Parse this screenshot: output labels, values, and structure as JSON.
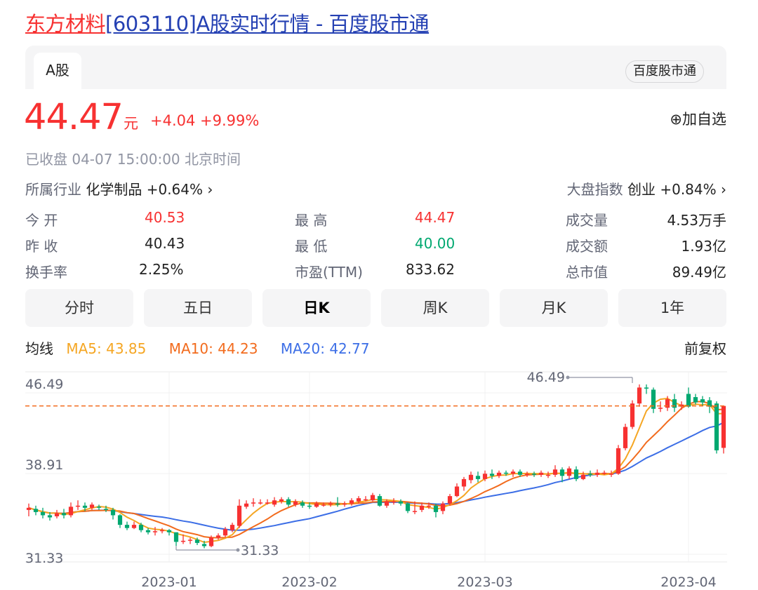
{
  "page_title": {
    "name": "东方材料",
    "code": "[603110]A股实时行情 - 百度股市通"
  },
  "tabs": {
    "active": "A股",
    "source": "百度股市通"
  },
  "quote": {
    "price": "44.47",
    "unit": "元",
    "change": "+4.04",
    "change_pct": "+9.99%",
    "watch_label": "⊕加自选",
    "status": "已收盘  04-07 15:00:00  北京时间",
    "industry_label": "所属行业",
    "industry_value": "化学制品 +0.64% ›",
    "index_label": "大盘指数",
    "index_value": "创业 +0.84% ›"
  },
  "stats": [
    {
      "label": "今    开",
      "value": "40.53",
      "color": "#f73131"
    },
    {
      "label": "最    高",
      "value": "44.47",
      "color": "#f73131"
    },
    {
      "label": "成交量",
      "value": "4.53万手",
      "color": "#222222"
    },
    {
      "label": "昨    收",
      "value": "40.43",
      "color": "#222222"
    },
    {
      "label": "最    低",
      "value": "40.00",
      "color": "#00a870"
    },
    {
      "label": "成交额",
      "value": "1.93亿",
      "color": "#222222"
    },
    {
      "label": "换手率",
      "value": "2.25%",
      "color": "#222222"
    },
    {
      "label": "市盈(TTM)",
      "value": "833.62",
      "color": "#222222"
    },
    {
      "label": "总市值",
      "value": "89.49亿",
      "color": "#222222"
    }
  ],
  "periods": [
    "分时",
    "五日",
    "日K",
    "周K",
    "月K",
    "1年"
  ],
  "active_period": "日K",
  "legend": {
    "label": "均线",
    "ma5": "MA5: 43.85",
    "ma10": "MA10: 44.23",
    "ma20": "MA20: 42.77",
    "adjust": "前复权"
  },
  "colors": {
    "up": "#f73131",
    "down": "#00a870",
    "ma5": "#f5a623",
    "ma10": "#f26b1d",
    "ma20": "#3c6ee6",
    "last_price_line": "#f26b1d"
  },
  "chart_data": {
    "type": "candlestick",
    "ylim": [
      31.33,
      46.49
    ],
    "y_ticks": [
      "46.49",
      "38.91",
      "31.33"
    ],
    "x_ticks": [
      "2023-01",
      "2023-02",
      "2023-03",
      "2023-04"
    ],
    "x_tick_index": [
      20,
      40,
      65,
      94
    ],
    "high_marker": {
      "label": "46.49",
      "value": 46.49,
      "index": 86
    },
    "low_marker": {
      "label": "31.33",
      "value": 31.33,
      "index": 21
    },
    "last_price": 44.47,
    "candles": [
      {
        "o": 34.7,
        "c": 34.9,
        "h": 35.3,
        "l": 34.1
      },
      {
        "o": 34.8,
        "c": 34.5,
        "h": 35.1,
        "l": 34.2
      },
      {
        "o": 34.5,
        "c": 34.2,
        "h": 34.9,
        "l": 33.9
      },
      {
        "o": 34.2,
        "c": 34.0,
        "h": 34.5,
        "l": 33.7
      },
      {
        "o": 34.1,
        "c": 34.4,
        "h": 34.7,
        "l": 33.9
      },
      {
        "o": 34.4,
        "c": 34.2,
        "h": 34.8,
        "l": 33.9
      },
      {
        "o": 34.2,
        "c": 35.0,
        "h": 35.4,
        "l": 34.0
      },
      {
        "o": 35.0,
        "c": 35.1,
        "h": 35.6,
        "l": 34.7
      },
      {
        "o": 35.1,
        "c": 34.9,
        "h": 35.4,
        "l": 34.6
      },
      {
        "o": 34.9,
        "c": 35.2,
        "h": 35.4,
        "l": 34.7
      },
      {
        "o": 35.0,
        "c": 34.9,
        "h": 35.2,
        "l": 34.7
      },
      {
        "o": 34.8,
        "c": 34.7,
        "h": 35.1,
        "l": 34.5
      },
      {
        "o": 34.7,
        "c": 34.2,
        "h": 34.9,
        "l": 33.8
      },
      {
        "o": 34.2,
        "c": 33.3,
        "h": 34.3,
        "l": 33.0
      },
      {
        "o": 33.3,
        "c": 33.0,
        "h": 33.6,
        "l": 32.8
      },
      {
        "o": 33.0,
        "c": 33.3,
        "h": 33.6,
        "l": 32.9
      },
      {
        "o": 33.3,
        "c": 32.8,
        "h": 33.5,
        "l": 32.6
      },
      {
        "o": 32.8,
        "c": 32.6,
        "h": 33.0,
        "l": 32.4
      },
      {
        "o": 32.6,
        "c": 32.7,
        "h": 33.1,
        "l": 32.3
      },
      {
        "o": 32.7,
        "c": 32.8,
        "h": 33.0,
        "l": 32.5
      },
      {
        "o": 32.8,
        "c": 32.6,
        "h": 32.9,
        "l": 32.3
      },
      {
        "o": 32.6,
        "c": 31.7,
        "h": 32.6,
        "l": 31.33
      },
      {
        "o": 31.8,
        "c": 31.8,
        "h": 32.4,
        "l": 31.5
      },
      {
        "o": 31.8,
        "c": 31.9,
        "h": 32.1,
        "l": 31.5
      },
      {
        "o": 31.9,
        "c": 31.6,
        "h": 32.1,
        "l": 31.4
      },
      {
        "o": 31.5,
        "c": 31.3,
        "h": 31.8,
        "l": 31.1
      },
      {
        "o": 31.3,
        "c": 32.1,
        "h": 32.3,
        "l": 31.2
      },
      {
        "o": 32.1,
        "c": 32.3,
        "h": 32.5,
        "l": 31.9
      },
      {
        "o": 32.3,
        "c": 32.9,
        "h": 33.1,
        "l": 32.1
      },
      {
        "o": 32.8,
        "c": 33.3,
        "h": 33.5,
        "l": 32.6
      },
      {
        "o": 33.2,
        "c": 35.1,
        "h": 35.7,
        "l": 33.0
      },
      {
        "o": 35.0,
        "c": 35.3,
        "h": 35.6,
        "l": 34.8
      },
      {
        "o": 35.3,
        "c": 35.4,
        "h": 35.8,
        "l": 35.0
      },
      {
        "o": 35.4,
        "c": 35.4,
        "h": 35.7,
        "l": 35.2
      },
      {
        "o": 35.4,
        "c": 35.4,
        "h": 35.7,
        "l": 35.2
      },
      {
        "o": 35.2,
        "c": 35.6,
        "h": 35.9,
        "l": 35.0
      },
      {
        "o": 35.5,
        "c": 35.7,
        "h": 35.9,
        "l": 35.3
      },
      {
        "o": 35.7,
        "c": 35.2,
        "h": 35.9,
        "l": 35.0
      },
      {
        "o": 35.2,
        "c": 35.5,
        "h": 35.7,
        "l": 35.0
      },
      {
        "o": 35.4,
        "c": 35.1,
        "h": 35.6,
        "l": 34.9
      },
      {
        "o": 35.1,
        "c": 35.0,
        "h": 35.4,
        "l": 34.8
      },
      {
        "o": 35.0,
        "c": 35.3,
        "h": 35.5,
        "l": 34.9
      },
      {
        "o": 35.2,
        "c": 35.2,
        "h": 35.4,
        "l": 35.0
      },
      {
        "o": 35.2,
        "c": 35.3,
        "h": 35.5,
        "l": 35.0
      },
      {
        "o": 35.3,
        "c": 35.2,
        "h": 35.9,
        "l": 35.0
      },
      {
        "o": 35.2,
        "c": 35.3,
        "h": 35.5,
        "l": 35.0
      },
      {
        "o": 35.3,
        "c": 35.6,
        "h": 35.8,
        "l": 35.1
      },
      {
        "o": 35.5,
        "c": 35.8,
        "h": 36.0,
        "l": 35.3
      },
      {
        "o": 35.7,
        "c": 35.7,
        "h": 36.0,
        "l": 35.5
      },
      {
        "o": 35.6,
        "c": 36.1,
        "h": 36.3,
        "l": 35.5
      },
      {
        "o": 36.0,
        "c": 35.1,
        "h": 36.2,
        "l": 35.0
      },
      {
        "o": 35.1,
        "c": 35.5,
        "h": 35.7,
        "l": 34.9
      },
      {
        "o": 35.4,
        "c": 35.5,
        "h": 35.8,
        "l": 35.2
      },
      {
        "o": 35.5,
        "c": 35.3,
        "h": 35.7,
        "l": 35.1
      },
      {
        "o": 35.3,
        "c": 34.6,
        "h": 35.4,
        "l": 34.4
      },
      {
        "o": 34.6,
        "c": 34.6,
        "h": 35.5,
        "l": 34.3
      },
      {
        "o": 34.7,
        "c": 35.1,
        "h": 35.4,
        "l": 34.5
      },
      {
        "o": 35.1,
        "c": 35.1,
        "h": 35.4,
        "l": 34.8
      },
      {
        "o": 35.1,
        "c": 34.5,
        "h": 35.3,
        "l": 34.0
      },
      {
        "o": 34.6,
        "c": 35.3,
        "h": 35.5,
        "l": 34.3
      },
      {
        "o": 35.3,
        "c": 36.0,
        "h": 36.2,
        "l": 35.1
      },
      {
        "o": 36.0,
        "c": 36.9,
        "h": 37.2,
        "l": 35.9
      },
      {
        "o": 36.9,
        "c": 37.6,
        "h": 37.8,
        "l": 36.5
      },
      {
        "o": 37.5,
        "c": 38.0,
        "h": 38.3,
        "l": 37.2
      },
      {
        "o": 37.9,
        "c": 37.6,
        "h": 38.3,
        "l": 37.3
      },
      {
        "o": 37.6,
        "c": 38.1,
        "h": 38.4,
        "l": 37.4
      },
      {
        "o": 38.1,
        "c": 37.9,
        "h": 38.5,
        "l": 37.6
      },
      {
        "o": 37.9,
        "c": 38.2,
        "h": 38.4,
        "l": 37.7
      },
      {
        "o": 38.2,
        "c": 38.1,
        "h": 38.4,
        "l": 37.9
      },
      {
        "o": 38.1,
        "c": 38.3,
        "h": 38.5,
        "l": 37.8
      },
      {
        "o": 38.3,
        "c": 38.0,
        "h": 38.5,
        "l": 37.8
      },
      {
        "o": 38.0,
        "c": 38.1,
        "h": 38.3,
        "l": 37.8
      },
      {
        "o": 38.1,
        "c": 38.0,
        "h": 38.3,
        "l": 37.8
      },
      {
        "o": 38.0,
        "c": 38.2,
        "h": 38.4,
        "l": 37.8
      },
      {
        "o": 38.0,
        "c": 38.0,
        "h": 38.3,
        "l": 37.7
      },
      {
        "o": 38.0,
        "c": 38.5,
        "h": 38.9,
        "l": 37.8
      },
      {
        "o": 38.5,
        "c": 37.9,
        "h": 38.7,
        "l": 37.3
      },
      {
        "o": 37.9,
        "c": 38.6,
        "h": 38.8,
        "l": 37.6
      },
      {
        "o": 38.5,
        "c": 37.6,
        "h": 38.8,
        "l": 37.4
      },
      {
        "o": 37.6,
        "c": 38.0,
        "h": 38.3,
        "l": 37.5
      },
      {
        "o": 38.1,
        "c": 38.0,
        "h": 38.4,
        "l": 37.8
      },
      {
        "o": 38.0,
        "c": 38.2,
        "h": 38.5,
        "l": 37.8
      },
      {
        "o": 38.2,
        "c": 38.2,
        "h": 38.4,
        "l": 38.0
      },
      {
        "o": 38.1,
        "c": 38.1,
        "h": 38.4,
        "l": 37.8
      },
      {
        "o": 38.1,
        "c": 40.5,
        "h": 40.8,
        "l": 38.0
      },
      {
        "o": 40.5,
        "c": 42.5,
        "h": 42.8,
        "l": 40.3
      },
      {
        "o": 42.5,
        "c": 44.7,
        "h": 45.0,
        "l": 42.3
      },
      {
        "o": 44.7,
        "c": 46.2,
        "h": 46.49,
        "l": 44.4
      },
      {
        "o": 46.2,
        "c": 46.1,
        "h": 46.49,
        "l": 45.6
      },
      {
        "o": 46.0,
        "c": 44.2,
        "h": 46.2,
        "l": 43.8
      },
      {
        "o": 44.2,
        "c": 44.3,
        "h": 44.9,
        "l": 43.9
      },
      {
        "o": 44.3,
        "c": 45.1,
        "h": 45.4,
        "l": 44.0
      },
      {
        "o": 45.1,
        "c": 44.3,
        "h": 45.6,
        "l": 43.9
      },
      {
        "o": 44.4,
        "c": 44.6,
        "h": 44.9,
        "l": 44.1
      },
      {
        "o": 45.6,
        "c": 44.4,
        "h": 46.2,
        "l": 44.3
      },
      {
        "o": 45.3,
        "c": 44.8,
        "h": 45.6,
        "l": 44.6
      },
      {
        "o": 45.1,
        "c": 44.8,
        "h": 45.4,
        "l": 44.5
      },
      {
        "o": 45.0,
        "c": 44.4,
        "h": 45.3,
        "l": 43.8
      },
      {
        "o": 44.7,
        "c": 40.3,
        "h": 44.9,
        "l": 40.0
      },
      {
        "o": 40.53,
        "c": 44.47,
        "h": 44.47,
        "l": 40.0
      }
    ],
    "ma5_end": 43.85,
    "ma10_end": 44.23,
    "ma20_end": 42.77
  }
}
